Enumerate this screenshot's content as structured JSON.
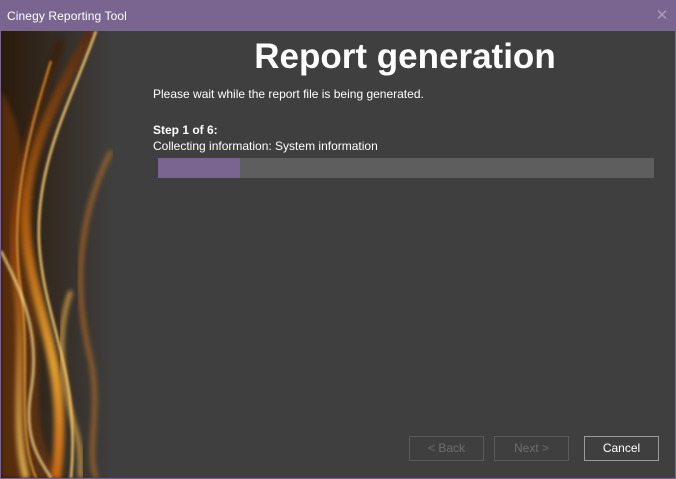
{
  "window": {
    "title": "Cinegy Reporting Tool",
    "close_glyph": "✕"
  },
  "main": {
    "heading": "Report generation",
    "intro": "Please wait while the report file is being generated.",
    "step_label": "Step 1 of 6:",
    "step_detail": "Collecting information: System information",
    "progress_fraction": 0.165
  },
  "buttons": {
    "back": "< Back",
    "next": "Next >",
    "cancel": "Cancel"
  },
  "colors": {
    "accent": "#7a6590",
    "background": "#3f3f3f",
    "progress_track": "#5e5e5e"
  }
}
